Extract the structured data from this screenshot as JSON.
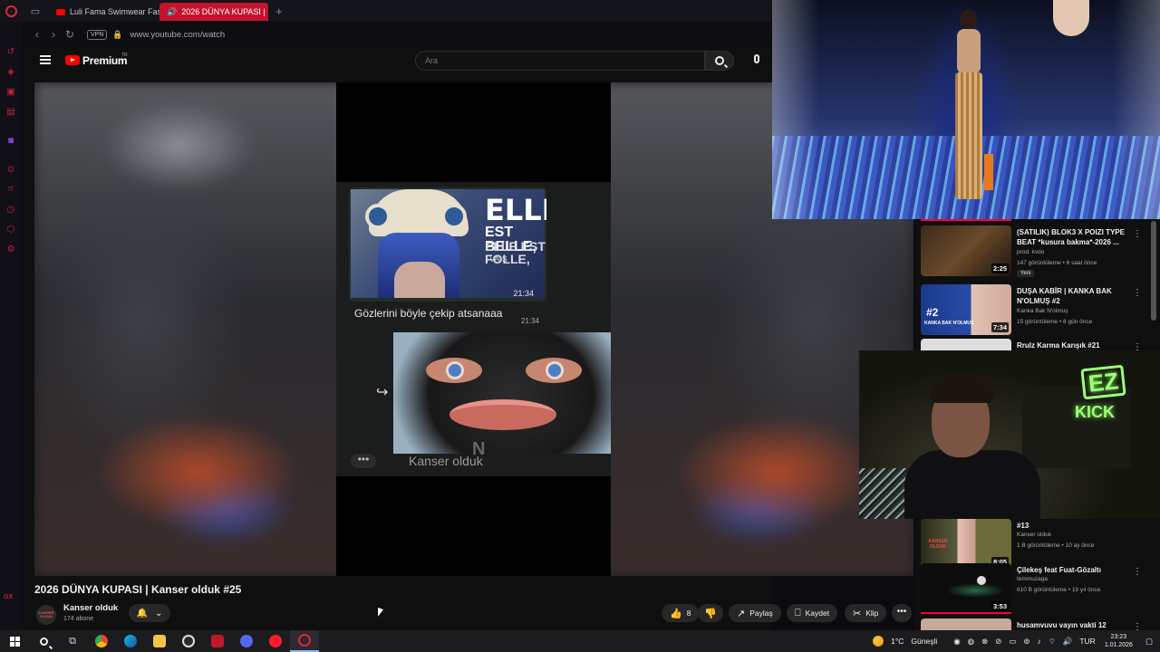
{
  "browser": {
    "tabs": [
      {
        "label": "Luli Fama Swimwear Fash"
      },
      {
        "label": "2026 DÜNYA KUPASI |",
        "active": true
      }
    ],
    "new_tab": "+",
    "vpn_label": "VPN",
    "url": "www.youtube.com/watch"
  },
  "youtube": {
    "brand": "Premium",
    "brand_region": "TR",
    "search_placeholder": "Ara"
  },
  "video": {
    "chat_text_elle": "ELLE",
    "chat_text_belle": "EST BELLE,",
    "chat_text_folle": "ELLE EST FOLLE,",
    "chat_text_vais": "VAIS",
    "msg1_time": "21:34",
    "msg2_text": "Gözlerini böyle çekip atsanaaa",
    "msg2_time": "21:34",
    "watermark": "Kanser olduk",
    "watermark_letter": "N",
    "title": "2026 DÜNYA KUPASI | Kanser olduk #25",
    "channel": "Kanser olduk",
    "channel_avatar_text": "KANSER OLDUK",
    "subscribers": "174 abone",
    "likes": "8",
    "share": "Paylaş",
    "save": "Kaydet",
    "clip": "Klip"
  },
  "suggestions": [
    {
      "title": "(SATILIK) BLOK3 X POIZI TYPE BEAT *kusura bakma*-2026 ...",
      "channel": "prod. kvdo",
      "meta": "147 görüntüleme • 6 saat önce",
      "badge": "Yeni",
      "duration": "2:25"
    },
    {
      "title": "DUŞA KABİR | KANKA BAK N'OLMUŞ #2",
      "channel": "Kanka Bak N'olmuş",
      "meta": "15 görüntüleme • 8 gün önce",
      "duration": "7:34",
      "thumb_text": "#2",
      "thumb_sub": "KANKA BAK N'OLMUŞ"
    },
    {
      "title": "Rrulz Karma Karışık #21"
    },
    {
      "title": "#13",
      "channel": "Kanser olduk",
      "meta": "1 B görüntüleme • 10 ay önce",
      "duration": "8:05",
      "thumb_text": "KANSER OLDUK"
    },
    {
      "title": "Çilekeş feat Fuat-Gözaltı",
      "channel": "temmuzaga",
      "meta": "610 B görüntüleme • 19 yıl önce",
      "duration": "3:53"
    },
    {
      "title": "husamvuvu vayın vakti 12"
    }
  ],
  "overlay": {
    "ez": "EZ",
    "kick": "KICK"
  },
  "taskbar": {
    "temperature": "1°C",
    "weather": "Güneşli",
    "language": "TUR",
    "time": "23:23",
    "date": "1.01.2026"
  }
}
